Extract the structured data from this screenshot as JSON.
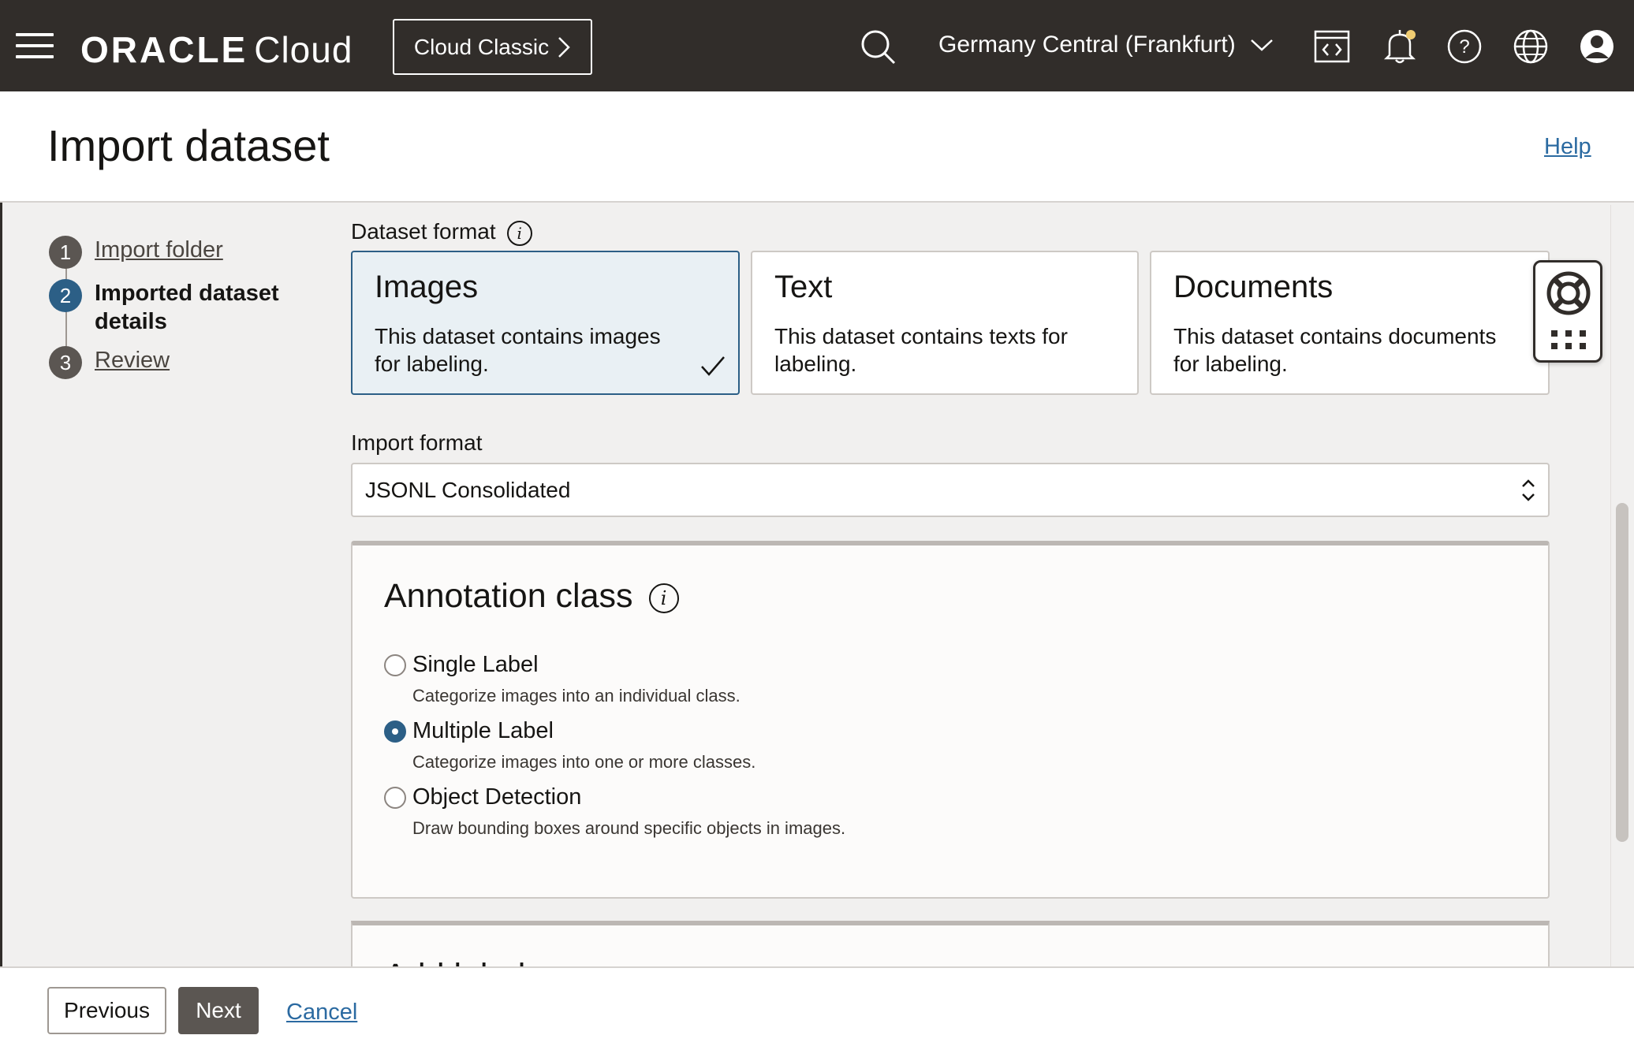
{
  "topbar": {
    "logo_oracle": "ORACLE",
    "logo_cloud": "Cloud",
    "classic_button": "Cloud Classic",
    "region": "Germany Central (Frankfurt)"
  },
  "header": {
    "title": "Import dataset",
    "help": "Help"
  },
  "steps": [
    {
      "number": "1",
      "label": "Import folder"
    },
    {
      "number": "2",
      "label": "Imported dataset details"
    },
    {
      "number": "3",
      "label": "Review"
    }
  ],
  "dataset_format": {
    "label": "Dataset format",
    "options": [
      {
        "title": "Images",
        "description": "This dataset contains images for labeling.",
        "selected": true
      },
      {
        "title": "Text",
        "description": "This dataset contains texts for labeling.",
        "selected": false
      },
      {
        "title": "Documents",
        "description": "This dataset contains documents for labeling.",
        "selected": false
      }
    ]
  },
  "import_format": {
    "label": "Import format",
    "value": "JSONL Consolidated"
  },
  "annotation_class": {
    "title": "Annotation class",
    "options": [
      {
        "label": "Single Label",
        "description": "Categorize images into an individual class.",
        "checked": false
      },
      {
        "label": "Multiple Label",
        "description": "Categorize images into one or more classes.",
        "checked": true
      },
      {
        "label": "Object Detection",
        "description": "Draw bounding boxes around specific objects in images.",
        "checked": false
      }
    ]
  },
  "add_labels": {
    "title": "Add labels"
  },
  "footer": {
    "previous": "Previous",
    "next": "Next",
    "cancel": "Cancel"
  },
  "colors": {
    "topbar": "#312d2a",
    "accent": "#2c5f86",
    "link": "#2b6aa1"
  }
}
